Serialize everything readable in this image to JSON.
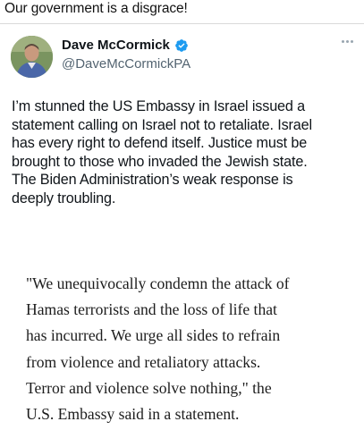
{
  "post_caption": "Our government is a disgrace!",
  "tweet": {
    "display_name": "Dave McCormick",
    "handle": "@DaveMcCormickPA",
    "verified": true,
    "more_icon": "more-horizontal-icon",
    "body_lines": [
      "I’m stunned the US Embassy in Israel issued a",
      "statement calling on Israel not to retaliate. Israel",
      "has every right to defend itself. Justice must be",
      "brought to those who invaded the Jewish state.",
      "The Biden Administration’s weak response is",
      "deeply troubling."
    ]
  },
  "quoted_statement": {
    "lines": [
      "\"We unequivocally condemn the attack of",
      "Hamas terrorists and the loss of life that",
      "has incurred. We urge all sides to refrain",
      "from violence and retaliatory attacks.",
      "Terror and violence solve nothing,\" the",
      "U.S. Embassy said in a statement."
    ]
  },
  "colors": {
    "verified_badge": "#1d9bf0",
    "handle": "#536471",
    "text": "#0f1419"
  }
}
